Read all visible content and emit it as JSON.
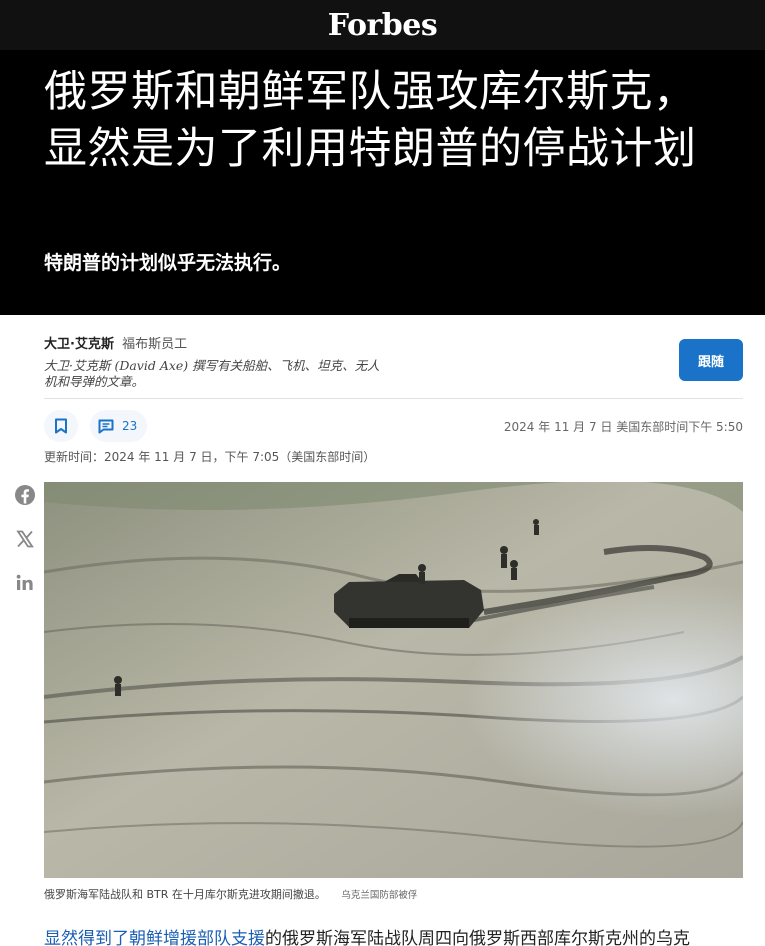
{
  "header": {
    "logo": "Forbes"
  },
  "article": {
    "headline": "俄罗斯和朝鲜军队强攻库尔斯克，显然是为了利用特朗普的停战计划",
    "dek": "特朗普的计划似乎无法执行。",
    "author": {
      "name": "大卫·艾克斯",
      "role": "福布斯员工",
      "bio": "大卫·艾克斯 (David Axe) 撰写有关船舶、飞机、坦克、无人机和导弹的文章。",
      "follow_label": "跟随"
    },
    "actions": {
      "comment_count": "23"
    },
    "published": "2024 年 11 月 7 日 美国东部时间下午 5:50",
    "updated": "更新时间：2024 年 11 月 7 日，下午 7:05（美国东部时间）",
    "image": {
      "caption": "俄罗斯海军陆战队和 BTR 在十月库尔斯克进攻期间撤退。",
      "credit": "乌克兰国防部被俘"
    },
    "body_first": {
      "link_text": "显然得到了朝鲜增援部队支援",
      "rest": "的俄罗斯海军陆战队周四向俄罗斯西部库尔斯克州的乌克"
    }
  },
  "share": {
    "icons": [
      "facebook-icon",
      "x-icon",
      "linkedin-icon"
    ]
  },
  "colors": {
    "accent": "#1a73c8",
    "hero_bg": "#000000",
    "topbar_bg": "#111111"
  }
}
